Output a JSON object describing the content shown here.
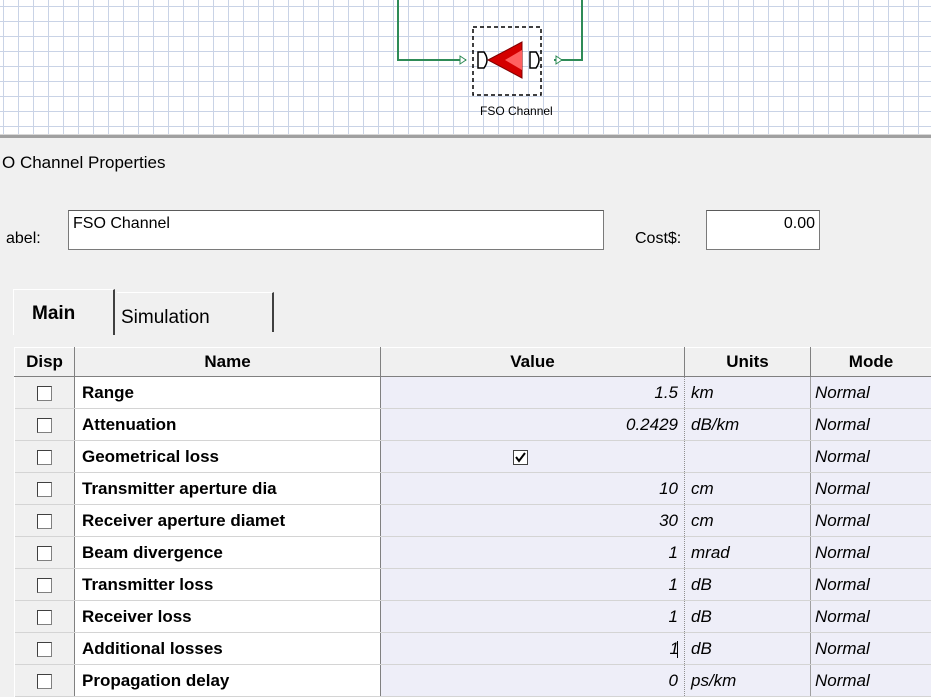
{
  "canvas": {
    "component_label": "FSO Channel"
  },
  "window": {
    "title": "O Channel Properties"
  },
  "fields": {
    "label_caption": "abel:",
    "label_value": "FSO Channel",
    "cost_caption": "Cost$:",
    "cost_value": "0.00"
  },
  "tabs": [
    {
      "label": "Main",
      "active": true
    },
    {
      "label": "Simulation",
      "active": false
    }
  ],
  "table": {
    "headers": {
      "disp": "Disp",
      "name": "Name",
      "value": "Value",
      "units": "Units",
      "mode": "Mode"
    },
    "rows": [
      {
        "name": "Range",
        "value": "1.5",
        "units": "km",
        "mode": "Normal"
      },
      {
        "name": "Attenuation",
        "value": "0.2429",
        "units": "dB/km",
        "mode": "Normal"
      },
      {
        "name": "Geometrical loss",
        "value": "",
        "checked": true,
        "units": "",
        "mode": "Normal"
      },
      {
        "name": "Transmitter aperture dia",
        "value": "10",
        "units": "cm",
        "mode": "Normal"
      },
      {
        "name": "Receiver aperture diamet",
        "value": "30",
        "units": "cm",
        "mode": "Normal"
      },
      {
        "name": "Beam divergence",
        "value": "1",
        "units": "mrad",
        "mode": "Normal"
      },
      {
        "name": "Transmitter loss",
        "value": "1",
        "units": "dB",
        "mode": "Normal"
      },
      {
        "name": "Receiver loss",
        "value": "1",
        "units": "dB",
        "mode": "Normal"
      },
      {
        "name": "Additional losses",
        "value": "1",
        "units": "dB",
        "mode": "Normal"
      },
      {
        "name": "Propagation delay",
        "value": "0",
        "units": "ps/km",
        "mode": "Normal"
      }
    ]
  },
  "colors": {
    "grid": "#c9d3e6",
    "wire": "#2e8b57",
    "component": "#cc0000"
  }
}
